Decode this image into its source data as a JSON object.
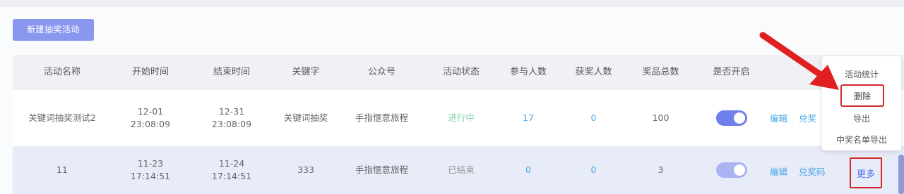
{
  "toolbar": {
    "create_label": "新建抽奖活动"
  },
  "table": {
    "headers": [
      "活动名称",
      "开始时间",
      "结束时间",
      "关键字",
      "公众号",
      "活动状态",
      "参与人数",
      "获奖人数",
      "奖品总数",
      "是否开启",
      ""
    ],
    "rows": [
      {
        "name": "关键词抽奖测试2",
        "start_date": "12-01",
        "start_time": "23:08:09",
        "end_date": "12-31",
        "end_time": "23:08:09",
        "keyword": "关键词抽奖",
        "account": "手指惬意旅程",
        "status": "进行中",
        "participants": "17",
        "winners": "0",
        "prizes": "100",
        "enabled": true,
        "op_edit": "编辑",
        "op_second": "兑奖"
      },
      {
        "name": "11",
        "start_date": "11-23",
        "start_time": "17:14:51",
        "end_date": "11-24",
        "end_time": "17:14:51",
        "keyword": "333",
        "account": "手指惬意旅程",
        "status": "已结束",
        "participants": "0",
        "winners": "0",
        "prizes": "3",
        "enabled": true,
        "op_edit": "编辑",
        "op_second": "兑奖码",
        "op_more": "更多"
      }
    ]
  },
  "dropdown": {
    "items": [
      "活动统计",
      "删除",
      "导出",
      "中奖名单导出"
    ]
  },
  "colors": {
    "accent": "#8a97ef",
    "link": "#48a7e8",
    "highlight_red": "#d12a2a",
    "status_active": "#7fd3a8"
  },
  "icons": {
    "annotation": "red-arrow-icon"
  }
}
